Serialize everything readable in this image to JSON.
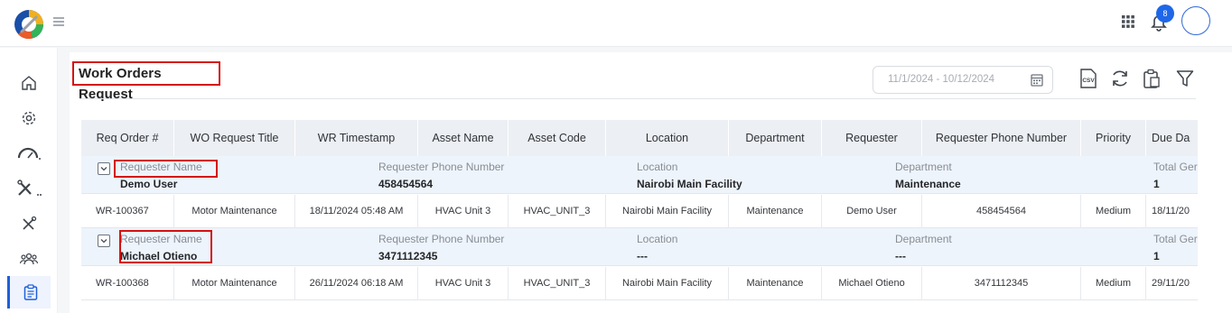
{
  "header": {
    "notification_count": "8"
  },
  "page": {
    "title": "Work Orders Request",
    "date_range_placeholder": "11/1/2024 - 10/12/2024",
    "csv_label": "CSV"
  },
  "table": {
    "columns": [
      "Req Order #",
      "WO Request Title",
      "WR Timestamp",
      "Asset Name",
      "Asset Code",
      "Location",
      "Department",
      "Requester",
      "Requester Phone Number",
      "Priority",
      "Due Da"
    ],
    "groups": [
      {
        "fields": [
          {
            "label": "Requester Name",
            "value": "Demo User"
          },
          {
            "label": "Requester Phone Number",
            "value": "458454564"
          },
          {
            "label": "Location",
            "value": "Nairobi Main Facility"
          },
          {
            "label": "Department",
            "value": "Maintenance"
          },
          {
            "label": "Total Ger",
            "value": "1"
          }
        ],
        "row": [
          "WR-100367",
          "Motor Maintenance",
          "18/11/2024 05:48 AM",
          "HVAC Unit 3",
          "HVAC_UNIT_3",
          "Nairobi Main Facility",
          "Maintenance",
          "Demo User",
          "458454564",
          "Medium",
          "18/11/20"
        ]
      },
      {
        "fields": [
          {
            "label": "Requester Name",
            "value": "Michael Otieno"
          },
          {
            "label": "Requester Phone Number",
            "value": "3471112345"
          },
          {
            "label": "Location",
            "value": "---"
          },
          {
            "label": "Department",
            "value": "---"
          },
          {
            "label": "Total Ger",
            "value": "1"
          }
        ],
        "row": [
          "WR-100368",
          "Motor Maintenance",
          "26/11/2024 06:18 AM",
          "HVAC Unit 3",
          "HVAC_UNIT_3",
          "Nairobi Main Facility",
          "Maintenance",
          "Michael Otieno",
          "3471112345",
          "Medium",
          "29/11/20"
        ]
      }
    ]
  },
  "icons": {
    "sidebar": [
      "home-icon",
      "settings-icon",
      "gauge-icon",
      "tools-icon",
      "wrench-screwdriver-icon",
      "team-icon",
      "clipboard-icon"
    ],
    "toolbar": [
      "csv-export-icon",
      "refresh-icon",
      "clipboard-icon",
      "filter-icon"
    ]
  },
  "colors": {
    "accent": "#1e67e8",
    "highlight_box": "#d41111",
    "group_row_bg": "#eef4fb",
    "header_bg": "#eceff3"
  }
}
